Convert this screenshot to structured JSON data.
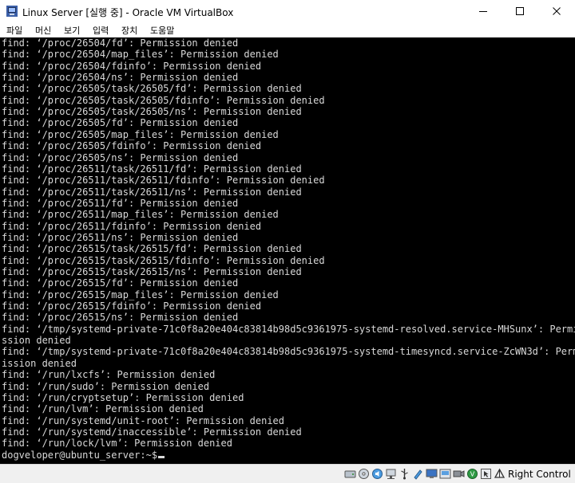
{
  "window": {
    "title": "Linux Server [실행 중] - Oracle VM VirtualBox"
  },
  "menu": {
    "items": [
      "파일",
      "머신",
      "보기",
      "입력",
      "장치",
      "도움말"
    ]
  },
  "terminal": {
    "lines": [
      "find: ‘/proc/26504/fd’: Permission denied",
      "find: ‘/proc/26504/map_files’: Permission denied",
      "find: ‘/proc/26504/fdinfo’: Permission denied",
      "find: ‘/proc/26504/ns’: Permission denied",
      "find: ‘/proc/26505/task/26505/fd’: Permission denied",
      "find: ‘/proc/26505/task/26505/fdinfo’: Permission denied",
      "find: ‘/proc/26505/task/26505/ns’: Permission denied",
      "find: ‘/proc/26505/fd’: Permission denied",
      "find: ‘/proc/26505/map_files’: Permission denied",
      "find: ‘/proc/26505/fdinfo’: Permission denied",
      "find: ‘/proc/26505/ns’: Permission denied",
      "find: ‘/proc/26511/task/26511/fd’: Permission denied",
      "find: ‘/proc/26511/task/26511/fdinfo’: Permission denied",
      "find: ‘/proc/26511/task/26511/ns’: Permission denied",
      "find: ‘/proc/26511/fd’: Permission denied",
      "find: ‘/proc/26511/map_files’: Permission denied",
      "find: ‘/proc/26511/fdinfo’: Permission denied",
      "find: ‘/proc/26511/ns’: Permission denied",
      "find: ‘/proc/26515/task/26515/fd’: Permission denied",
      "find: ‘/proc/26515/task/26515/fdinfo’: Permission denied",
      "find: ‘/proc/26515/task/26515/ns’: Permission denied",
      "find: ‘/proc/26515/fd’: Permission denied",
      "find: ‘/proc/26515/map_files’: Permission denied",
      "find: ‘/proc/26515/fdinfo’: Permission denied",
      "find: ‘/proc/26515/ns’: Permission denied",
      "find: ‘/tmp/systemd-private-71c0f8a20e404c83814b98d5c9361975-systemd-resolved.service-MHSunx’: Permi",
      "ssion denied",
      "find: ‘/tmp/systemd-private-71c0f8a20e404c83814b98d5c9361975-systemd-timesyncd.service-ZcWN3d’: Perm",
      "ission denied",
      "find: ‘/run/lxcfs’: Permission denied",
      "find: ‘/run/sudo’: Permission denied",
      "find: ‘/run/cryptsetup’: Permission denied",
      "find: ‘/run/lvm’: Permission denied",
      "find: ‘/run/systemd/unit-root’: Permission denied",
      "find: ‘/run/systemd/inaccessible’: Permission denied",
      "find: ‘/run/lock/lvm’: Permission denied"
    ],
    "prompt": "dogveloper@ubuntu_server:~$"
  },
  "statusbar": {
    "icons": [
      "hard-disk-icon",
      "optical-disk-icon",
      "audio-icon",
      "network-icon",
      "usb-icon",
      "shared-folders-icon",
      "display-icon",
      "video-capture-icon",
      "virtualization-icon",
      "mouse-integration-icon",
      "keyboard-icon"
    ],
    "host_key": "Right Control"
  }
}
